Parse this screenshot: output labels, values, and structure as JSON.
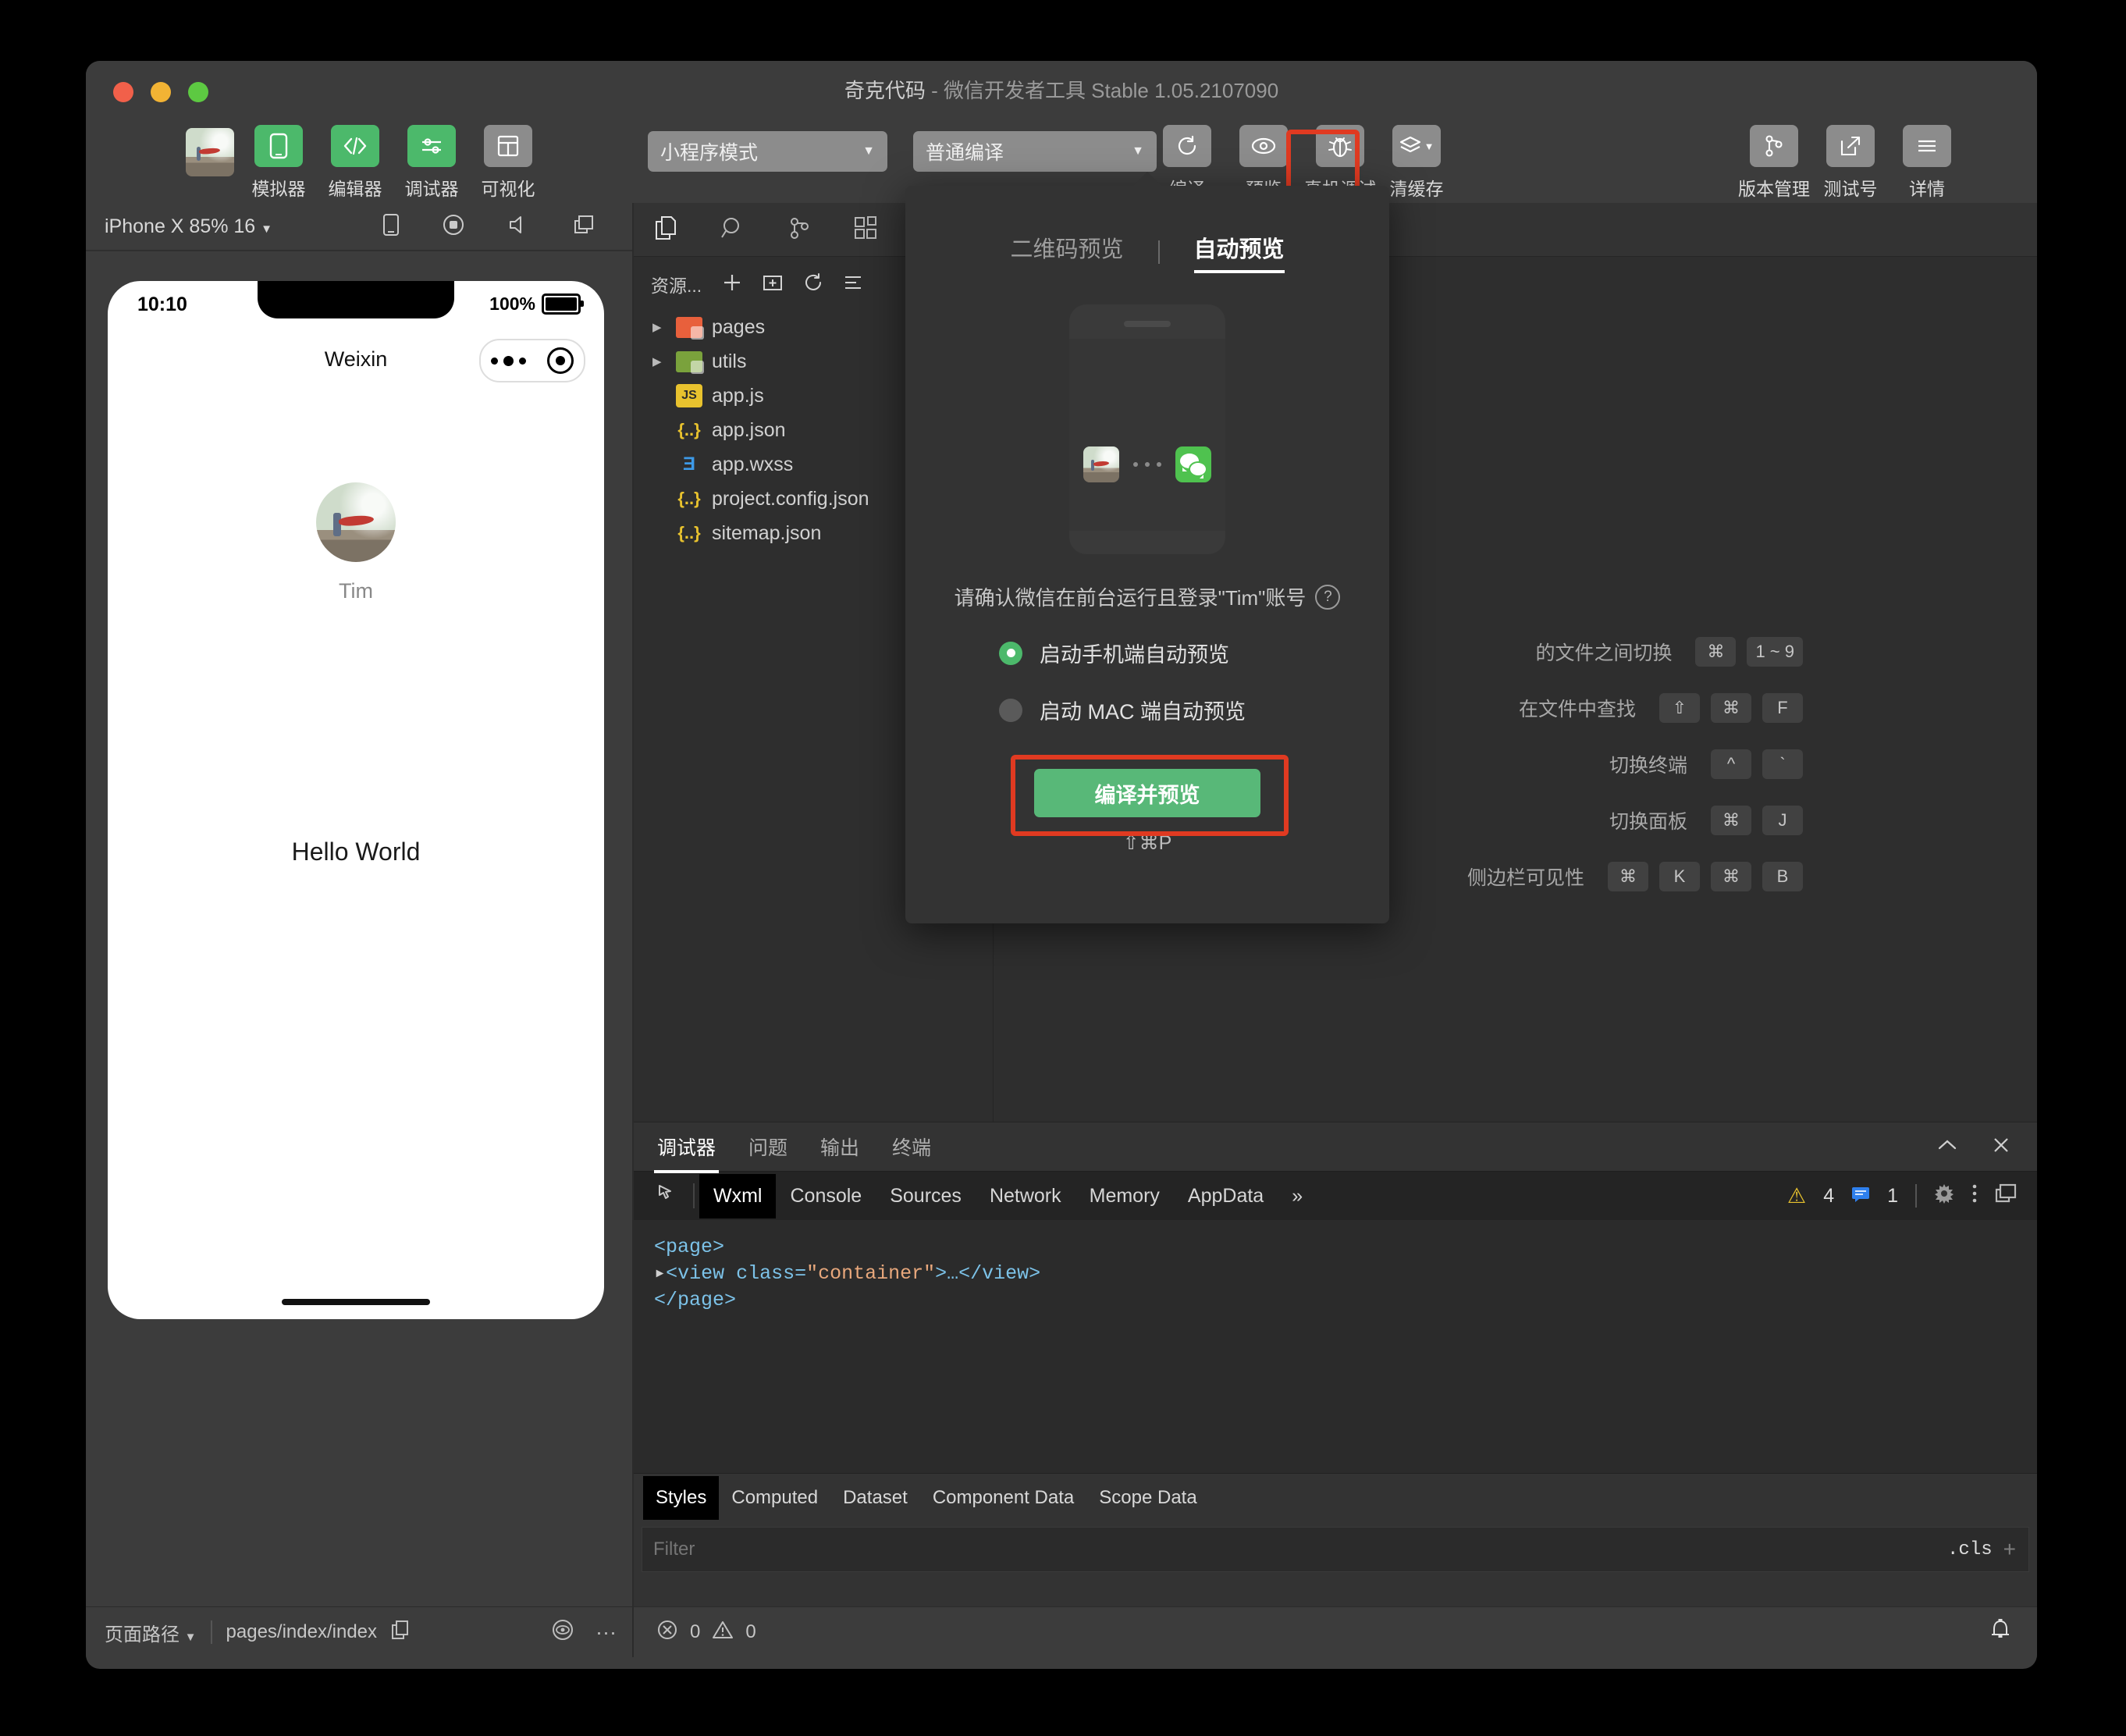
{
  "window": {
    "title_main": "奇克代码",
    "title_sub": " - 微信开发者工具 Stable 1.05.2107090"
  },
  "toolbar": {
    "left_items": [
      {
        "label": "模拟器",
        "icon": "phone-icon",
        "style": "green"
      },
      {
        "label": "编辑器",
        "icon": "code-icon",
        "style": "green"
      },
      {
        "label": "调试器",
        "icon": "sliders-icon",
        "style": "green"
      },
      {
        "label": "可视化",
        "icon": "layout-icon",
        "style": "grey"
      }
    ],
    "mode_select": "小程序模式",
    "compile_select": "普通编译",
    "mid_items": [
      {
        "label": "编译",
        "icon": "refresh-icon"
      },
      {
        "label": "预览",
        "icon": "eye-icon"
      },
      {
        "label": "真机调试",
        "icon": "bug-icon"
      },
      {
        "label": "清缓存",
        "icon": "layers-icon"
      }
    ],
    "right_items": [
      {
        "label": "版本管理",
        "icon": "branch-icon"
      },
      {
        "label": "测试号",
        "icon": "external-link-icon"
      },
      {
        "label": "详情",
        "icon": "menu-icon"
      }
    ]
  },
  "simulator": {
    "device": "iPhone X 85% 16",
    "status_time": "10:10",
    "battery": "100%",
    "nav_title": "Weixin",
    "user_name": "Tim",
    "page_text": "Hello World"
  },
  "explorer": {
    "title": "资源...",
    "items": [
      {
        "name": "pages",
        "type": "folder",
        "color": "orange",
        "expandable": true
      },
      {
        "name": "utils",
        "type": "folder",
        "color": "green",
        "expandable": true
      },
      {
        "name": "app.js",
        "type": "js",
        "expandable": false
      },
      {
        "name": "app.json",
        "type": "json",
        "expandable": false
      },
      {
        "name": "app.wxss",
        "type": "wxss",
        "expandable": false
      },
      {
        "name": "project.config.json",
        "type": "json",
        "expandable": false
      },
      {
        "name": "sitemap.json",
        "type": "json",
        "expandable": false
      }
    ]
  },
  "shortcuts": [
    {
      "label": "的文件之间切换",
      "keys": [
        "⌘",
        "1 ~ 9"
      ]
    },
    {
      "label": "在文件中查找",
      "keys": [
        "⇧",
        "⌘",
        "F"
      ]
    },
    {
      "label": "切换终端",
      "keys": [
        "^",
        "`"
      ]
    },
    {
      "label": "切换面板",
      "keys": [
        "⌘",
        "J"
      ]
    },
    {
      "label": "侧边栏可见性",
      "keys": [
        "⌘",
        "K",
        "⌘",
        "B"
      ]
    }
  ],
  "preview_popup": {
    "tabs": [
      {
        "label": "二维码预览",
        "active": false
      },
      {
        "label": "自动预览",
        "active": true
      }
    ],
    "confirm_text": "请确认微信在前台运行且登录\"Tim\"账号",
    "options": [
      {
        "label": "启动手机端自动预览",
        "selected": true
      },
      {
        "label": "启动 MAC 端自动预览",
        "selected": false
      }
    ],
    "button_label": "编译并预览",
    "button_shortcut": "⇧⌘P"
  },
  "debugger": {
    "panel_tabs": [
      {
        "label": "调试器",
        "active": true
      },
      {
        "label": "问题",
        "active": false
      },
      {
        "label": "输出",
        "active": false
      },
      {
        "label": "终端",
        "active": false
      }
    ],
    "devtools_tabs": [
      {
        "label": "Wxml",
        "active": true
      },
      {
        "label": "Console",
        "active": false
      },
      {
        "label": "Sources",
        "active": false
      },
      {
        "label": "Network",
        "active": false
      },
      {
        "label": "Memory",
        "active": false
      },
      {
        "label": "AppData",
        "active": false
      }
    ],
    "more_tabs": "»",
    "warning_count": "4",
    "info_count": "1",
    "wxml": {
      "line1": "<page>",
      "line2_open": "<view class=",
      "line2_value": "\"container\"",
      "line2_close": ">…</view>",
      "line3": "</page>"
    },
    "style_tabs": [
      {
        "label": "Styles",
        "active": true
      },
      {
        "label": "Computed",
        "active": false
      },
      {
        "label": "Dataset",
        "active": false
      },
      {
        "label": "Component Data",
        "active": false
      },
      {
        "label": "Scope Data",
        "active": false
      }
    ],
    "filter_placeholder": "Filter",
    "cls_label": ".cls"
  },
  "statusbar": {
    "path_label": "页面路径",
    "path_value": "pages/index/index",
    "error_count": "0",
    "warn_count": "0"
  },
  "colors": {
    "accent_green": "#4cb96b",
    "highlight_red": "#e03a21",
    "wechat_green": "#4fc24f",
    "warning_yellow": "#e8c22e"
  }
}
